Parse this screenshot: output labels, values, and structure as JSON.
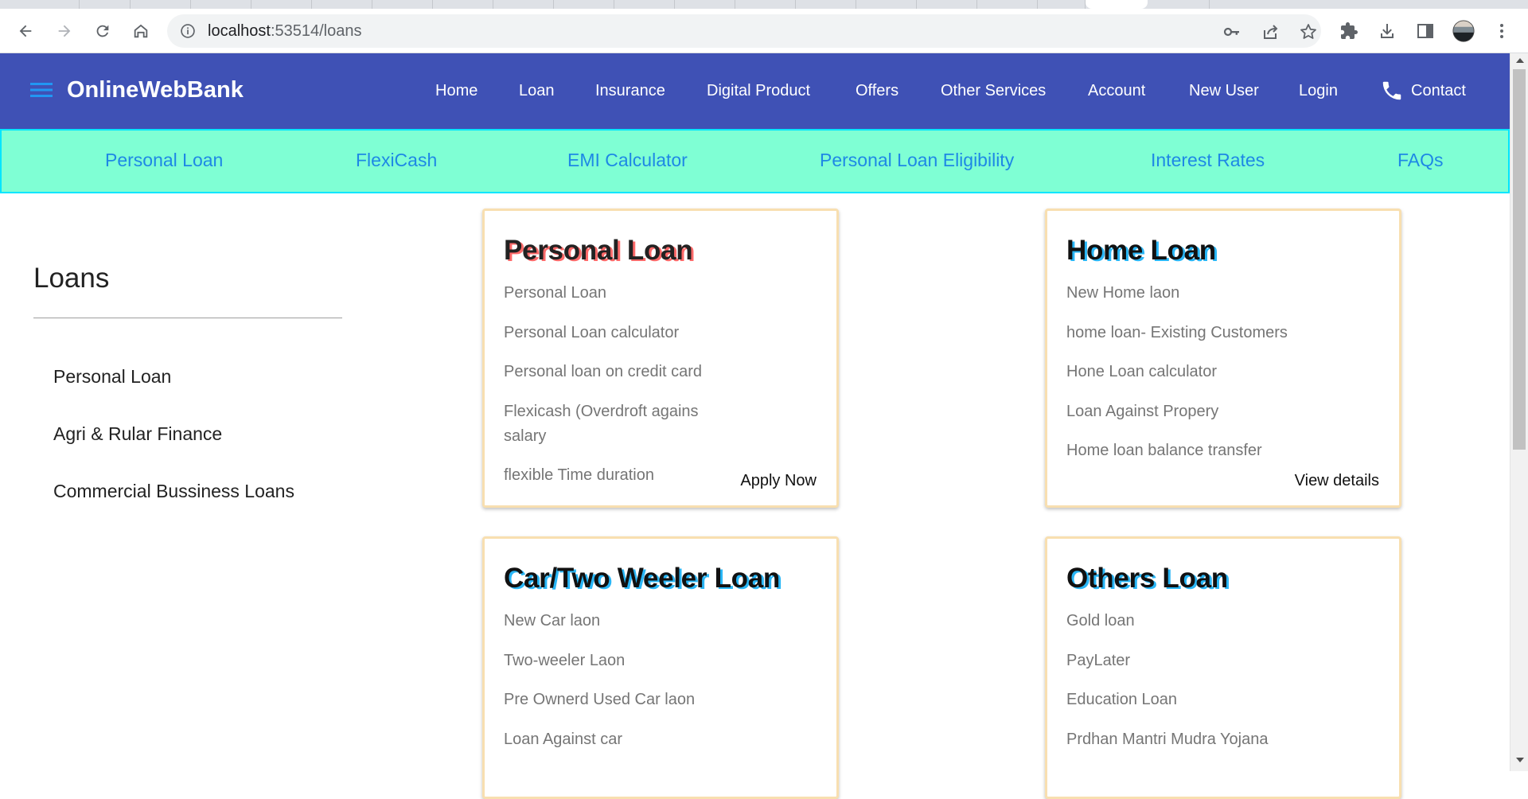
{
  "browser": {
    "url_host": "localhost",
    "url_rest": ":53514/loans"
  },
  "navbar": {
    "brand": "OnlineWebBank",
    "items": [
      "Home",
      "Loan",
      "Insurance",
      "Digital Product",
      "Offers",
      "Other Services",
      "Account",
      "New User",
      "Login",
      "Contact"
    ]
  },
  "subnav": {
    "items": [
      "Personal Loan",
      "FlexiCash",
      "EMI Calculator",
      "Personal Loan Eligibility",
      "Interest Rates",
      "FAQs"
    ]
  },
  "sidebar": {
    "title": "Loans",
    "items": [
      "Personal Loan",
      "Agri & Rular Finance",
      "Commercial Bussiness Loans"
    ]
  },
  "cards": [
    {
      "title": "Personal Loan",
      "items": [
        "Personal Loan",
        "Personal Loan calculator",
        "Personal loan on credit card",
        "Flexicash (Overdroft agains salary",
        "flexible Time duration"
      ],
      "action": "Apply Now"
    },
    {
      "title": "Home Loan",
      "items": [
        "New Home laon",
        "home loan- Existing Customers",
        "Hone Loan calculator",
        "Loan Against Propery",
        "Home loan balance transfer"
      ],
      "action": "View details"
    },
    {
      "title": "Car/Two Weeler Loan",
      "items": [
        "New Car laon",
        "Two-weeler Laon",
        "Pre Ownerd Used Car laon",
        "Loan Against car"
      ]
    },
    {
      "title": "Others Loan",
      "items": [
        "Gold loan",
        "PayLater",
        "Education Loan",
        "Prdhan Mantri Mudra Yojana"
      ]
    }
  ],
  "colors": {
    "navbar": "#3f51b5",
    "subnav": "#7fffd4",
    "subnav_link": "#1e88e5",
    "card_border": "#f8dfb0"
  }
}
